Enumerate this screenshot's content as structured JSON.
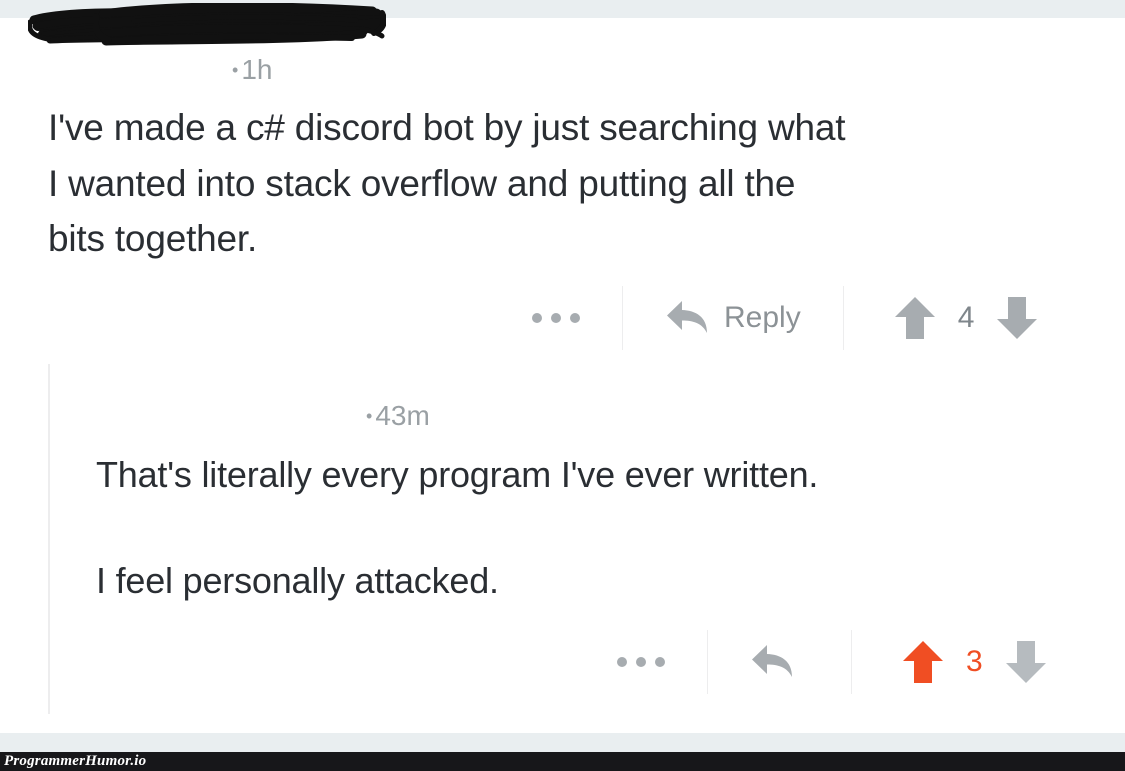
{
  "watermark": {
    "text": "ProgrammerHumor.io"
  },
  "colors": {
    "upvote_active": "#f04e23",
    "icon_gray": "#a7acb0",
    "text_dark": "#2a2e33",
    "meta_gray": "#9aa0a4",
    "band": "#e9eef0",
    "watermark_bar": "#17171a"
  },
  "comment": {
    "author": "",
    "author_redacted": true,
    "separator": "•",
    "timestamp": "1h",
    "body_lines": [
      "I've made a c# discord bot by just searching what",
      "I wanted into stack overflow and putting all the",
      "bits together."
    ],
    "actions": {
      "more_label": "•••",
      "more_icon": "ellipsis-icon",
      "reply_icon": "reply-arrow-icon",
      "reply_label": "Reply",
      "upvote_icon": "arrow-up-icon",
      "downvote_icon": "arrow-down-icon",
      "vote_count": "4",
      "vote_state": "none"
    }
  },
  "reply": {
    "author": "",
    "author_redacted": true,
    "separator": "•",
    "timestamp": "43m",
    "body_paragraphs": [
      "That's literally every program I've ever written.",
      "I feel personally attacked."
    ],
    "actions": {
      "more_label": "•••",
      "more_icon": "ellipsis-icon",
      "reply_icon": "reply-arrow-icon",
      "reply_label": "",
      "upvote_icon": "arrow-up-icon",
      "downvote_icon": "arrow-down-icon",
      "vote_count": "3",
      "vote_state": "upvoted"
    }
  }
}
